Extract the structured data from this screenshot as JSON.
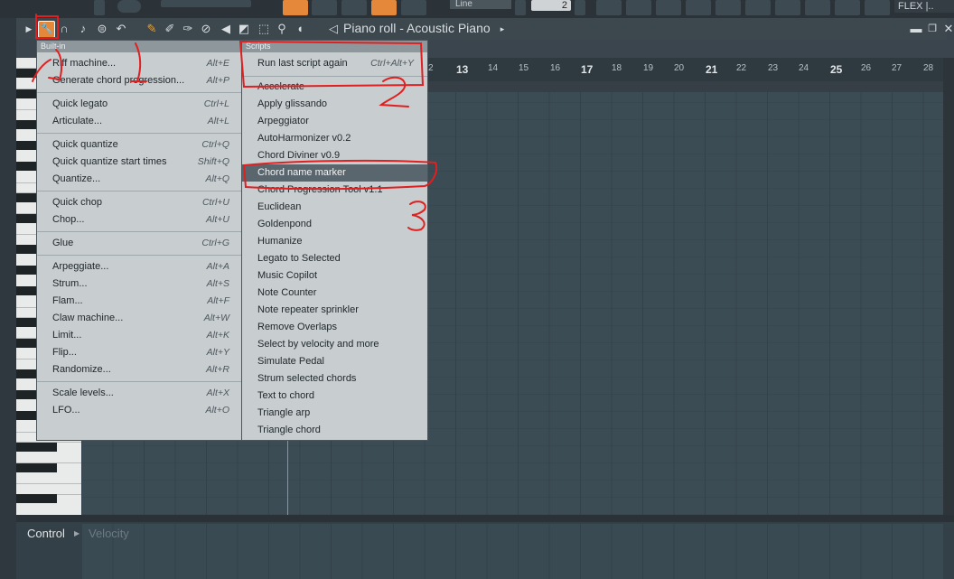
{
  "top_toolbar": {
    "line_select_value": "Line",
    "zoom_value": "2",
    "flex_label": "FLEX |.."
  },
  "piano_roll": {
    "title": "Piano roll - Acoustic Piano",
    "tools": [
      {
        "name": "tools-menu-icon"
      },
      {
        "name": "magnet-icon"
      },
      {
        "name": "note-icon"
      },
      {
        "name": "play-note-icon"
      },
      {
        "name": "undo-icon"
      },
      {
        "name": "pencil-icon"
      },
      {
        "name": "paint-brush-icon"
      },
      {
        "name": "delete-tool-icon"
      },
      {
        "name": "mute-icon"
      },
      {
        "name": "speaker-mute-icon"
      },
      {
        "name": "slice-icon"
      },
      {
        "name": "select-icon"
      },
      {
        "name": "zoom-icon"
      },
      {
        "name": "playback-icon"
      }
    ]
  },
  "ruler": {
    "labels": [
      {
        "t": "2",
        "big": false
      },
      {
        "t": "13",
        "big": true
      },
      {
        "t": "14",
        "big": false
      },
      {
        "t": "15",
        "big": false
      },
      {
        "t": "16",
        "big": false
      },
      {
        "t": "17",
        "big": true
      },
      {
        "t": "18",
        "big": false
      },
      {
        "t": "19",
        "big": false
      },
      {
        "t": "20",
        "big": false
      },
      {
        "t": "21",
        "big": true
      },
      {
        "t": "22",
        "big": false
      },
      {
        "t": "23",
        "big": false
      },
      {
        "t": "24",
        "big": false
      },
      {
        "t": "25",
        "big": true
      },
      {
        "t": "26",
        "big": false
      },
      {
        "t": "27",
        "big": false
      },
      {
        "t": "28",
        "big": false
      }
    ]
  },
  "builtin_menu": {
    "header": "Built-in",
    "groups": [
      [
        {
          "label": "Riff machine...",
          "shortcut": "Alt+E"
        },
        {
          "label": "Generate chord progression...",
          "shortcut": "Alt+P"
        }
      ],
      [
        {
          "label": "Quick legato",
          "shortcut": "Ctrl+L"
        },
        {
          "label": "Articulate...",
          "shortcut": "Alt+L"
        }
      ],
      [
        {
          "label": "Quick quantize",
          "shortcut": "Ctrl+Q"
        },
        {
          "label": "Quick quantize start times",
          "shortcut": "Shift+Q"
        },
        {
          "label": "Quantize...",
          "shortcut": "Alt+Q"
        }
      ],
      [
        {
          "label": "Quick chop",
          "shortcut": "Ctrl+U"
        },
        {
          "label": "Chop...",
          "shortcut": "Alt+U"
        }
      ],
      [
        {
          "label": "Glue",
          "shortcut": "Ctrl+G"
        }
      ],
      [
        {
          "label": "Arpeggiate...",
          "shortcut": "Alt+A"
        },
        {
          "label": "Strum...",
          "shortcut": "Alt+S"
        },
        {
          "label": "Flam...",
          "shortcut": "Alt+F"
        },
        {
          "label": "Claw machine...",
          "shortcut": "Alt+W"
        },
        {
          "label": "Limit...",
          "shortcut": "Alt+K"
        },
        {
          "label": "Flip...",
          "shortcut": "Alt+Y"
        },
        {
          "label": "Randomize...",
          "shortcut": "Alt+R"
        }
      ],
      [
        {
          "label": "Scale levels...",
          "shortcut": "Alt+X"
        },
        {
          "label": "LFO...",
          "shortcut": "Alt+O"
        }
      ]
    ]
  },
  "scripts_menu": {
    "header": "Scripts",
    "run_last": {
      "label": "Run last script again",
      "shortcut": "Ctrl+Alt+Y"
    },
    "items": [
      "Accelerate",
      "Apply glissando",
      "Arpeggiator",
      "AutoHarmonizer v0.2",
      "Chord Diviner v0.9",
      "Chord name marker",
      "Chord Progression Tool v1.1",
      "Euclidean",
      "Goldenpond",
      "Humanize",
      "Legato to Selected",
      "Music Copilot",
      "Note Counter",
      "Note repeater sprinkler",
      "Remove Overlaps",
      "Select by velocity and more",
      "Simulate Pedal",
      "Strum selected chords",
      "Text to chord",
      "Triangle arp",
      "Triangle chord"
    ],
    "highlighted": "Chord name marker"
  },
  "event_editor": {
    "control_label": "Control",
    "velocity_label": "Velocity"
  },
  "annotations": {
    "marks": [
      "1",
      "1",
      "2",
      "3"
    ],
    "color": "#e02020"
  }
}
